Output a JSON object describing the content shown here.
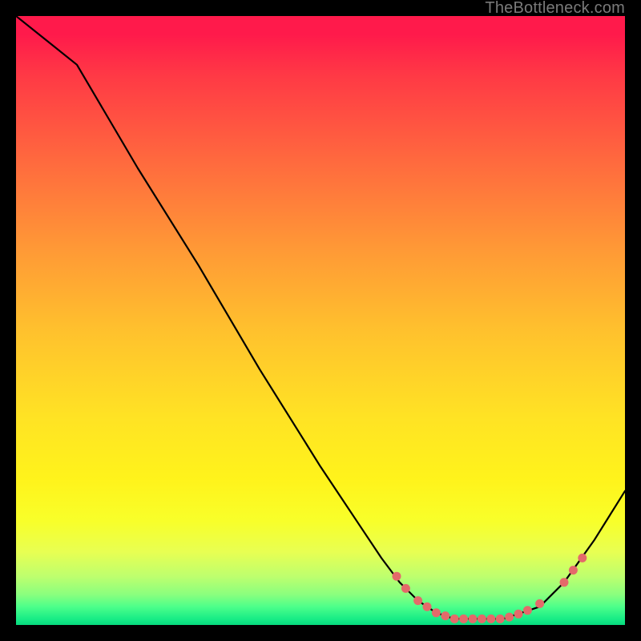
{
  "watermark": "TheBottleneck.com",
  "colors": {
    "page_bg": "#000000",
    "curve": "#000000",
    "dot": "#e46a6a",
    "gradient_top": "#ff1a4b",
    "gradient_mid": "#ffe324",
    "gradient_bottom": "#06d97e"
  },
  "chart_data": {
    "type": "line",
    "title": "",
    "xlabel": "",
    "ylabel": "",
    "x_range": [
      0,
      100
    ],
    "y_range": [
      0,
      100
    ],
    "annotations": [],
    "legend": [],
    "curve_xy_percent": [
      [
        0,
        100
      ],
      [
        5,
        96
      ],
      [
        10,
        92
      ],
      [
        20,
        75
      ],
      [
        30,
        59
      ],
      [
        40,
        42
      ],
      [
        50,
        26
      ],
      [
        56,
        17
      ],
      [
        60,
        11
      ],
      [
        63,
        7
      ],
      [
        66,
        4
      ],
      [
        69,
        2
      ],
      [
        72,
        1
      ],
      [
        76,
        1
      ],
      [
        80,
        1
      ],
      [
        83,
        2
      ],
      [
        86,
        3
      ],
      [
        90,
        7
      ],
      [
        95,
        14
      ],
      [
        100,
        22
      ]
    ],
    "dots_xy_percent": [
      [
        62.5,
        8
      ],
      [
        64,
        6
      ],
      [
        66,
        4
      ],
      [
        67.5,
        3
      ],
      [
        69,
        2
      ],
      [
        70.5,
        1.5
      ],
      [
        72,
        1
      ],
      [
        73.5,
        1
      ],
      [
        75,
        1
      ],
      [
        76.5,
        1
      ],
      [
        78,
        1
      ],
      [
        79.5,
        1
      ],
      [
        81,
        1.3
      ],
      [
        82.5,
        1.8
      ],
      [
        84,
        2.4
      ],
      [
        86,
        3.5
      ],
      [
        90,
        7
      ],
      [
        91.5,
        9
      ],
      [
        93,
        11
      ]
    ]
  }
}
